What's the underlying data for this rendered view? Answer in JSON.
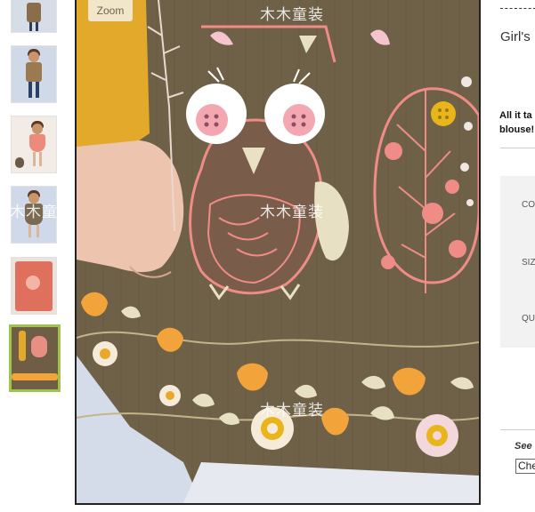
{
  "zoom": {
    "label": "Zoom"
  },
  "watermark": {
    "text": "木木童装"
  },
  "thumbnails": [
    {
      "id": "thumb-1",
      "palette": {
        "bg": "#d7dde6",
        "body": "#8a6e4b"
      }
    },
    {
      "id": "thumb-2",
      "palette": {
        "bg": "#cfd9e8",
        "body": "#9b7a52"
      }
    },
    {
      "id": "thumb-3",
      "palette": {
        "bg": "#f3ece6",
        "body": "#ec8a7c"
      }
    },
    {
      "id": "thumb-4",
      "palette": {
        "bg": "#cfd9ea",
        "body": "#7a6a52"
      }
    },
    {
      "id": "thumb-5",
      "palette": {
        "bg": "#e9e2dd",
        "body": "#e0705e"
      }
    },
    {
      "id": "thumb-6",
      "palette": {
        "bg": "#6f5d46",
        "body": "#e88f84"
      }
    }
  ],
  "product": {
    "title_fragment": "Girl's",
    "description_line1": "All it ta",
    "description_line2": "blouse!"
  },
  "options": {
    "color_label": "CO",
    "size_label": "SIZ",
    "quantity_label": "QU"
  },
  "see": {
    "label": "See",
    "select_value": "Che"
  },
  "colors": {
    "selected_border": "#9ec44b",
    "corduroy": "#6f6148",
    "sleeve": "#e3a92a",
    "owl_pink": "#f08c86",
    "flower_orange": "#f2a43b"
  }
}
